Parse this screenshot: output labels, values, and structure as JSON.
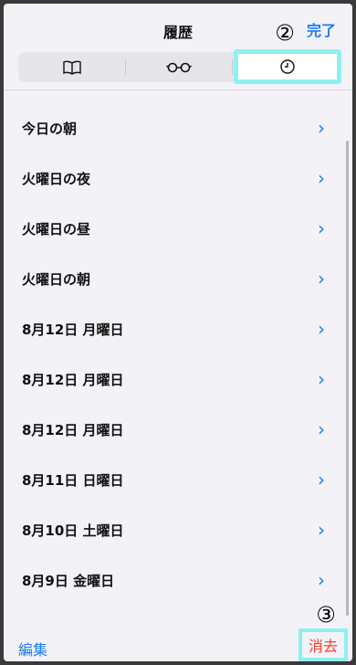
{
  "header": {
    "title": "履歴",
    "done_label": "完了",
    "annotation_2": "②"
  },
  "segments": [
    {
      "name": "bookmarks",
      "icon": "book-icon"
    },
    {
      "name": "reading-list",
      "icon": "glasses-icon"
    },
    {
      "name": "history",
      "icon": "clock-icon",
      "selected": true
    }
  ],
  "history": {
    "items": [
      {
        "label": "今日の朝",
        "chevron": "›"
      },
      {
        "label": "火曜日の夜",
        "chevron": "›"
      },
      {
        "label": "火曜日の昼",
        "chevron": "›"
      },
      {
        "label": "火曜日の朝",
        "chevron": "›"
      },
      {
        "label": "8月12日 月曜日",
        "chevron": "›"
      },
      {
        "label": "8月12日 月曜日",
        "chevron": "›"
      },
      {
        "label": "8月12日 月曜日",
        "chevron": "›"
      },
      {
        "label": "8月11日 日曜日",
        "chevron": "›"
      },
      {
        "label": "8月10日 土曜日",
        "chevron": "›"
      },
      {
        "label": "8月9日 金曜日",
        "chevron": "›"
      }
    ]
  },
  "toolbar": {
    "edit_label": "編集",
    "clear_label": "消去",
    "annotation_3": "③"
  },
  "colors": {
    "accent": "#1b7cf0",
    "destructive": "#ff3b30",
    "highlight": "#8ff0f2"
  }
}
